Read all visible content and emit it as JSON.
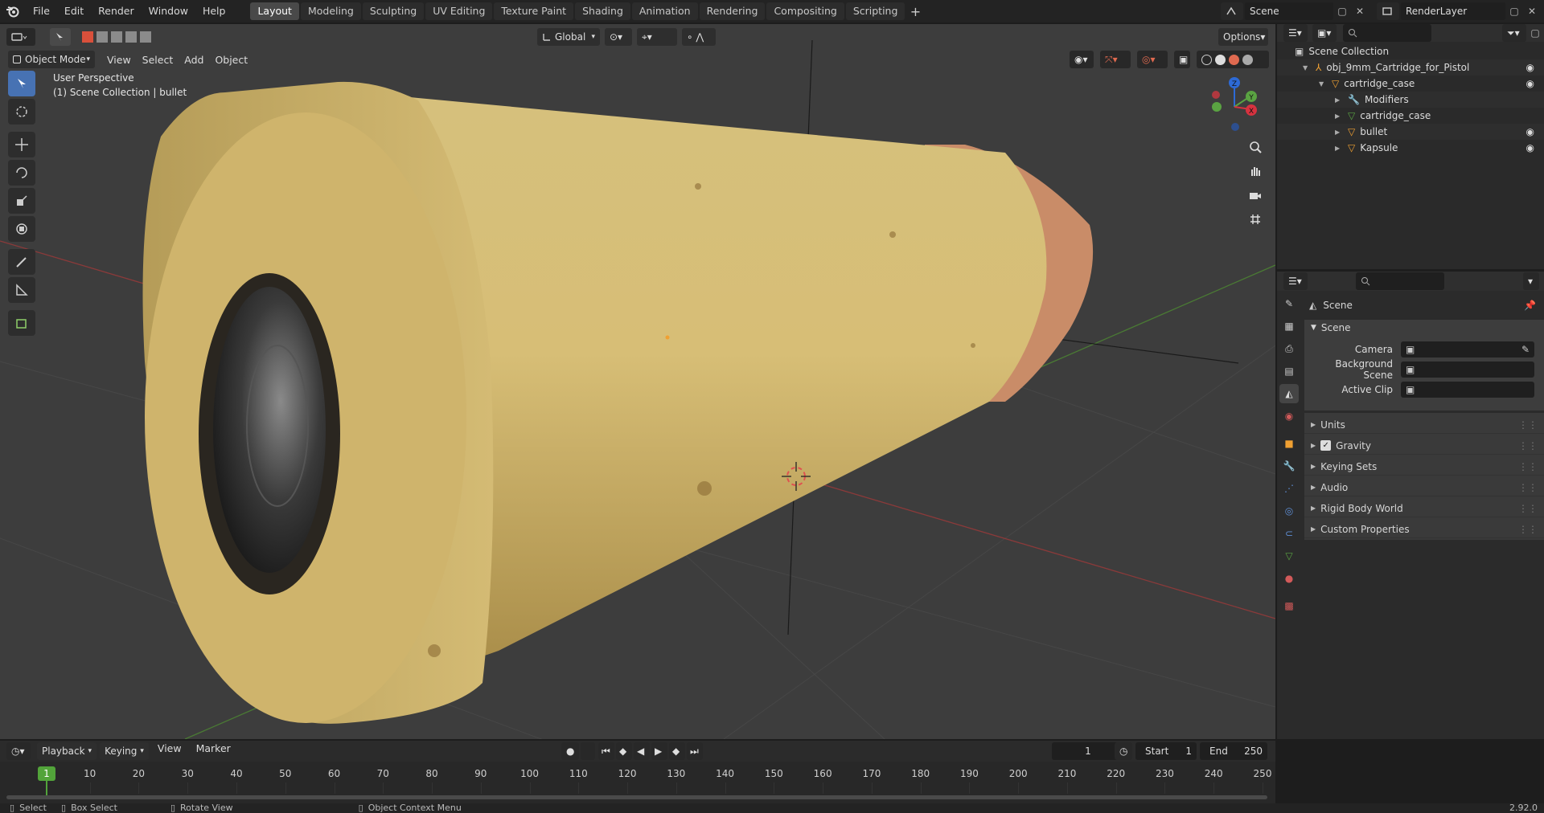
{
  "menubar": {
    "items": [
      "File",
      "Edit",
      "Render",
      "Window",
      "Help"
    ]
  },
  "workspaces": {
    "tabs": [
      "Layout",
      "Modeling",
      "Sculpting",
      "UV Editing",
      "Texture Paint",
      "Shading",
      "Animation",
      "Rendering",
      "Compositing",
      "Scripting"
    ],
    "active": "Layout"
  },
  "scene_selector": {
    "label": "Scene"
  },
  "layer_selector": {
    "label": "RenderLayer"
  },
  "viewport": {
    "mode": "Object Mode",
    "menus": [
      "View",
      "Select",
      "Add",
      "Object"
    ],
    "transform_orientation": "Global",
    "options_label": "Options",
    "overlay_line1": "User Perspective",
    "overlay_line2": "(1) Scene Collection | bullet",
    "gizmo": {
      "x": "X",
      "y": "Y",
      "z": "Z"
    }
  },
  "outliner": {
    "root": "Scene Collection",
    "items": [
      {
        "label": "obj_9mm_Cartridge_for_Pistol",
        "level": 1
      },
      {
        "label": "cartridge_case",
        "level": 2
      },
      {
        "label": "Modifiers",
        "level": 3
      },
      {
        "label": "cartridge_case",
        "level": 3
      },
      {
        "label": "bullet",
        "level": 3
      },
      {
        "label": "Kapsule",
        "level": 3
      }
    ]
  },
  "properties": {
    "breadcrumb": "Scene",
    "panel_title": "Scene",
    "fields": [
      {
        "label": "Camera"
      },
      {
        "label": "Background Scene"
      },
      {
        "label": "Active Clip"
      }
    ],
    "subpanels": [
      "Units",
      "Gravity",
      "Keying Sets",
      "Audio",
      "Rigid Body World",
      "Custom Properties"
    ],
    "gravity_checked": true
  },
  "timeline": {
    "menus": [
      "Playback",
      "Keying",
      "View",
      "Marker"
    ],
    "current_frame": "1",
    "start_label": "Start",
    "start": "1",
    "end_label": "End",
    "end": "250",
    "ticks": [
      "10",
      "20",
      "30",
      "40",
      "50",
      "60",
      "70",
      "80",
      "90",
      "100",
      "110",
      "120",
      "130",
      "140",
      "150",
      "160",
      "170",
      "180",
      "190",
      "200",
      "210",
      "220",
      "230",
      "240",
      "250"
    ],
    "playhead": "1"
  },
  "statusbar": {
    "select": "Select",
    "box_select": "Box Select",
    "rotate": "Rotate View",
    "context_menu": "Object Context Menu",
    "version": "2.92.0"
  },
  "colors": {
    "accent": "#4772b3",
    "selected_orange": "#f0a032",
    "timeline_playhead": "#52a43a"
  }
}
